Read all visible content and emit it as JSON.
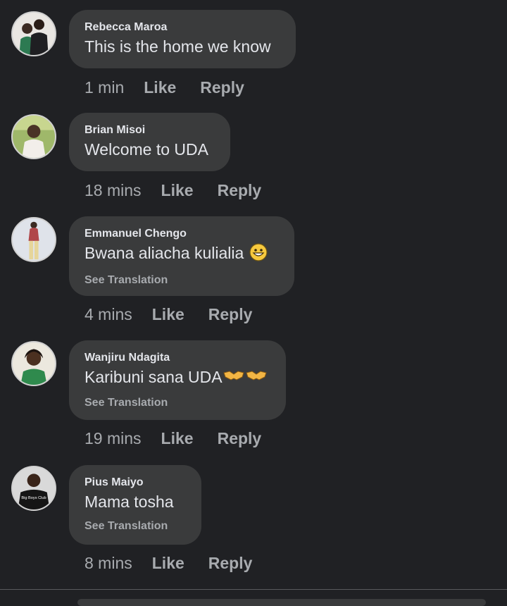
{
  "comments": [
    {
      "author": "Rebecca Maroa",
      "text": "This is the home we know",
      "time": "1 min",
      "like": "Like",
      "reply": "Reply"
    },
    {
      "author": "Brian Misoi",
      "text": "Welcome to UDA",
      "time": "18 mins",
      "like": "Like",
      "reply": "Reply"
    },
    {
      "author": "Emmanuel Chengo",
      "text": "Bwana aliacha kulialia",
      "translate": "See Translation",
      "time": "4 mins",
      "like": "Like",
      "reply": "Reply"
    },
    {
      "author": "Wanjiru Ndagita",
      "text": "Karibuni sana UDA",
      "translate": "See Translation",
      "time": "19 mins",
      "like": "Like",
      "reply": "Reply"
    },
    {
      "author": "Pius Maiyo",
      "text": "Mama tosha",
      "translate": "See Translation",
      "time": "8 mins",
      "like": "Like",
      "reply": "Reply",
      "avatar_shirt_text": "Big Boys Club"
    }
  ],
  "icons": {
    "emoji_grin": "grinning-face-emoji",
    "emoji_handshake": "handshake-emoji"
  },
  "colors": {
    "background": "#202124",
    "bubble": "#3a3b3c",
    "primary_text": "#e4e6eb",
    "secondary_text": "#a8abaf"
  }
}
